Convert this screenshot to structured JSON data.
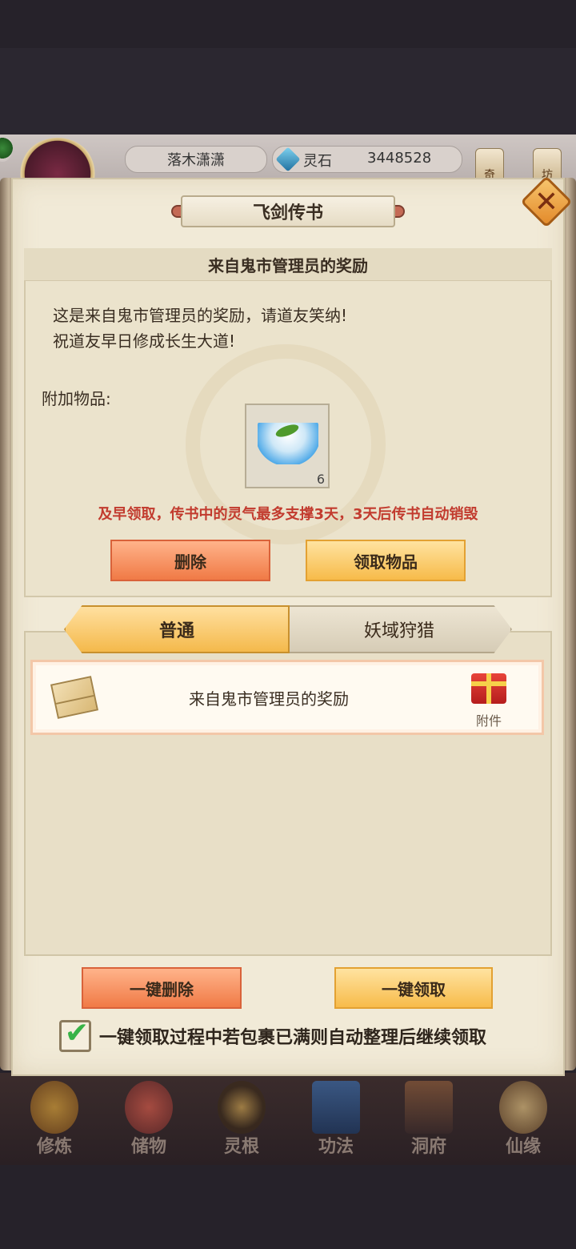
{
  "hud": {
    "player_name": "落木潇潇",
    "currency_label": "灵石",
    "currency_value": "3448528",
    "right_buttons": [
      "奇",
      "坊"
    ]
  },
  "dialog": {
    "title": "飞剑传书",
    "mail_subject": "来自鬼市管理员的奖励",
    "body_line1": "这是来自鬼市管理员的奖励，请道友笑纳!",
    "body_line2": "祝道友早日修成长生大道!",
    "attach_label": "附加物品:",
    "item_count": "6",
    "warning": "及早领取，传书中的灵气最多支撑3天，3天后传书自动销毁",
    "delete_label": "删除",
    "claim_label": "领取物品"
  },
  "tabs": [
    {
      "label": "普通",
      "active": true
    },
    {
      "label": "妖域狩猎",
      "active": false
    }
  ],
  "mail_list": [
    {
      "title": "来自鬼市管理员的奖励",
      "tag": "附件"
    }
  ],
  "footer": {
    "bulk_delete": "一键删除",
    "bulk_claim": "一键领取",
    "auto_sort_label": "一键领取过程中若包裹已满则自动整理后继续领取",
    "auto_sort_checked": true
  },
  "bottom_nav": [
    {
      "label": "修炼"
    },
    {
      "label": "储物"
    },
    {
      "label": "灵根"
    },
    {
      "label": "功法"
    },
    {
      "label": "洞府"
    },
    {
      "label": "仙缘"
    }
  ],
  "colors": {
    "warning": "#c23b2e",
    "gold_button": "#f7bb4a",
    "red_button": "#f07a46",
    "checkmark": "#37b347"
  }
}
